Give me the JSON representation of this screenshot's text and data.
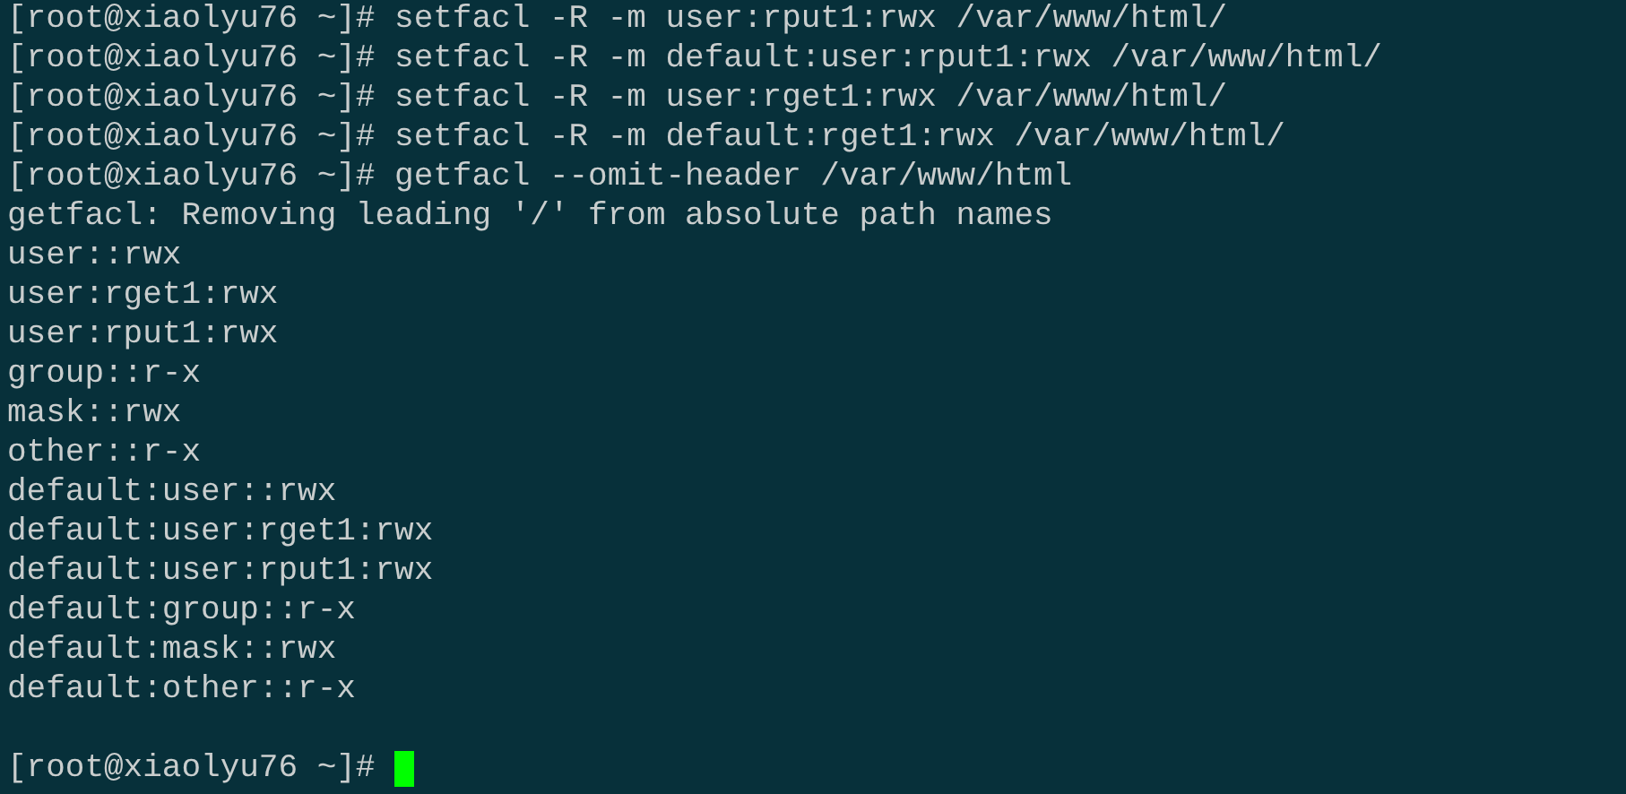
{
  "terminal": {
    "lines": [
      {
        "kind": "prompt",
        "prompt": "[root@xiaolyu76 ~]#",
        "command": "setfacl -R -m user:rput1:rwx /var/www/html/"
      },
      {
        "kind": "prompt",
        "prompt": "[root@xiaolyu76 ~]#",
        "command": "setfacl -R -m default:user:rput1:rwx /var/www/html/"
      },
      {
        "kind": "prompt",
        "prompt": "[root@xiaolyu76 ~]#",
        "command": "setfacl -R -m user:rget1:rwx /var/www/html/"
      },
      {
        "kind": "prompt",
        "prompt": "[root@xiaolyu76 ~]#",
        "command": "setfacl -R -m default:rget1:rwx /var/www/html/"
      },
      {
        "kind": "prompt",
        "prompt": "[root@xiaolyu76 ~]#",
        "command": "getfacl --omit-header /var/www/html"
      },
      {
        "kind": "output",
        "text": "getfacl: Removing leading '/' from absolute path names"
      },
      {
        "kind": "output",
        "text": "user::rwx"
      },
      {
        "kind": "output",
        "text": "user:rget1:rwx"
      },
      {
        "kind": "output",
        "text": "user:rput1:rwx"
      },
      {
        "kind": "output",
        "text": "group::r-x"
      },
      {
        "kind": "output",
        "text": "mask::rwx"
      },
      {
        "kind": "output",
        "text": "other::r-x"
      },
      {
        "kind": "output",
        "text": "default:user::rwx"
      },
      {
        "kind": "output",
        "text": "default:user:rget1:rwx"
      },
      {
        "kind": "output",
        "text": "default:user:rput1:rwx"
      },
      {
        "kind": "output",
        "text": "default:group::r-x"
      },
      {
        "kind": "output",
        "text": "default:mask::rwx"
      },
      {
        "kind": "output",
        "text": "default:other::r-x"
      },
      {
        "kind": "blank"
      },
      {
        "kind": "prompt",
        "prompt": "[root@xiaolyu76 ~]#",
        "cursor": true
      }
    ]
  }
}
